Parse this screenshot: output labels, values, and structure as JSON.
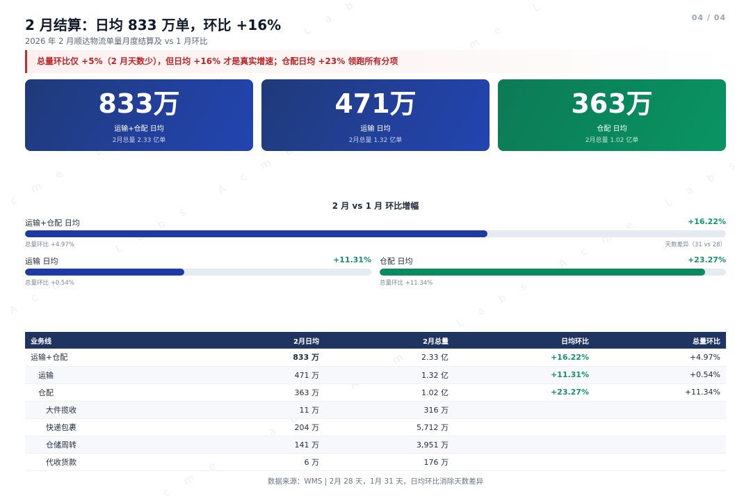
{
  "page_number": "04 / 04",
  "title": "2 月结算：日均 833 万单，环比 +16%",
  "subtitle": "2026 年 2 月顺达物流单量月度结算及 vs 1 月环比",
  "callout": "总量环比仅 +5%（2 月天数少），但日均 +16% 才是真实增速；仓配日均 +23% 领跑所有分项",
  "watermark_text": "Acme Labs",
  "kpis": [
    {
      "value": "833万",
      "label": "运输+仓配 日均",
      "sub": "2月总量 2.33 亿单",
      "color": "#1f3a78"
    },
    {
      "value": "471万",
      "label": "运输 日均",
      "sub": "2月总量 1.32 亿单",
      "color": "#1f3a78"
    },
    {
      "value": "363万",
      "label": "仓配 日均",
      "sub": "2月总量 1.02 亿单",
      "color": "#0a8a5e"
    }
  ],
  "growth": {
    "title": "2 月 vs 1 月 环比增幅",
    "total": {
      "label": "运输+仓配 日均",
      "pct": "+16.22%",
      "fill": 0.66,
      "note_left": "总量环比 +4.97%",
      "note_right": "天数差异（31 vs 28）"
    },
    "transport": {
      "label": "运输 日均",
      "pct": "+11.31%",
      "fill": 0.46,
      "note_left": "总量环比 +0.54%"
    },
    "warehouse": {
      "label": "仓配 日均",
      "pct": "+23.27%",
      "fill": 0.94,
      "note_left": "总量环比 +11.34%"
    }
  },
  "table": {
    "headers": [
      "业务线",
      "2月日均",
      "2月总量",
      "日均环比",
      "总量环比"
    ],
    "rows": [
      {
        "name": "运输+仓配",
        "daily": "833 万",
        "total": "2.33 亿",
        "daily_mom": "+16.22%",
        "total_mom": "+4.97%"
      },
      {
        "name": "运输",
        "daily": "471 万",
        "total": "1.32 亿",
        "daily_mom": "+11.31%",
        "total_mom": "+0.54%"
      },
      {
        "name": "仓配",
        "daily": "363 万",
        "total": "1.02 亿",
        "daily_mom": "+23.27%",
        "total_mom": "+11.34%"
      },
      {
        "name": "大件揽收",
        "daily": "11 万",
        "total": "316 万",
        "daily_mom": "",
        "total_mom": ""
      },
      {
        "name": "快递包裹",
        "daily": "204 万",
        "total": "5,712 万",
        "daily_mom": "",
        "total_mom": ""
      },
      {
        "name": "仓储周转",
        "daily": "141 万",
        "total": "3,951 万",
        "daily_mom": "",
        "total_mom": ""
      },
      {
        "name": "代收货款",
        "daily": "6 万",
        "total": "176 万",
        "daily_mom": "",
        "total_mom": ""
      }
    ]
  },
  "footer": "数据来源：WMS | 2月 28 天，1月 31 天，日均环比消除天数差异",
  "colors": {
    "accent_blue": "#1f3aa3",
    "accent_green": "#0a8a5e",
    "alert_red": "#c92c2c",
    "header_navy": "#1f3460"
  }
}
